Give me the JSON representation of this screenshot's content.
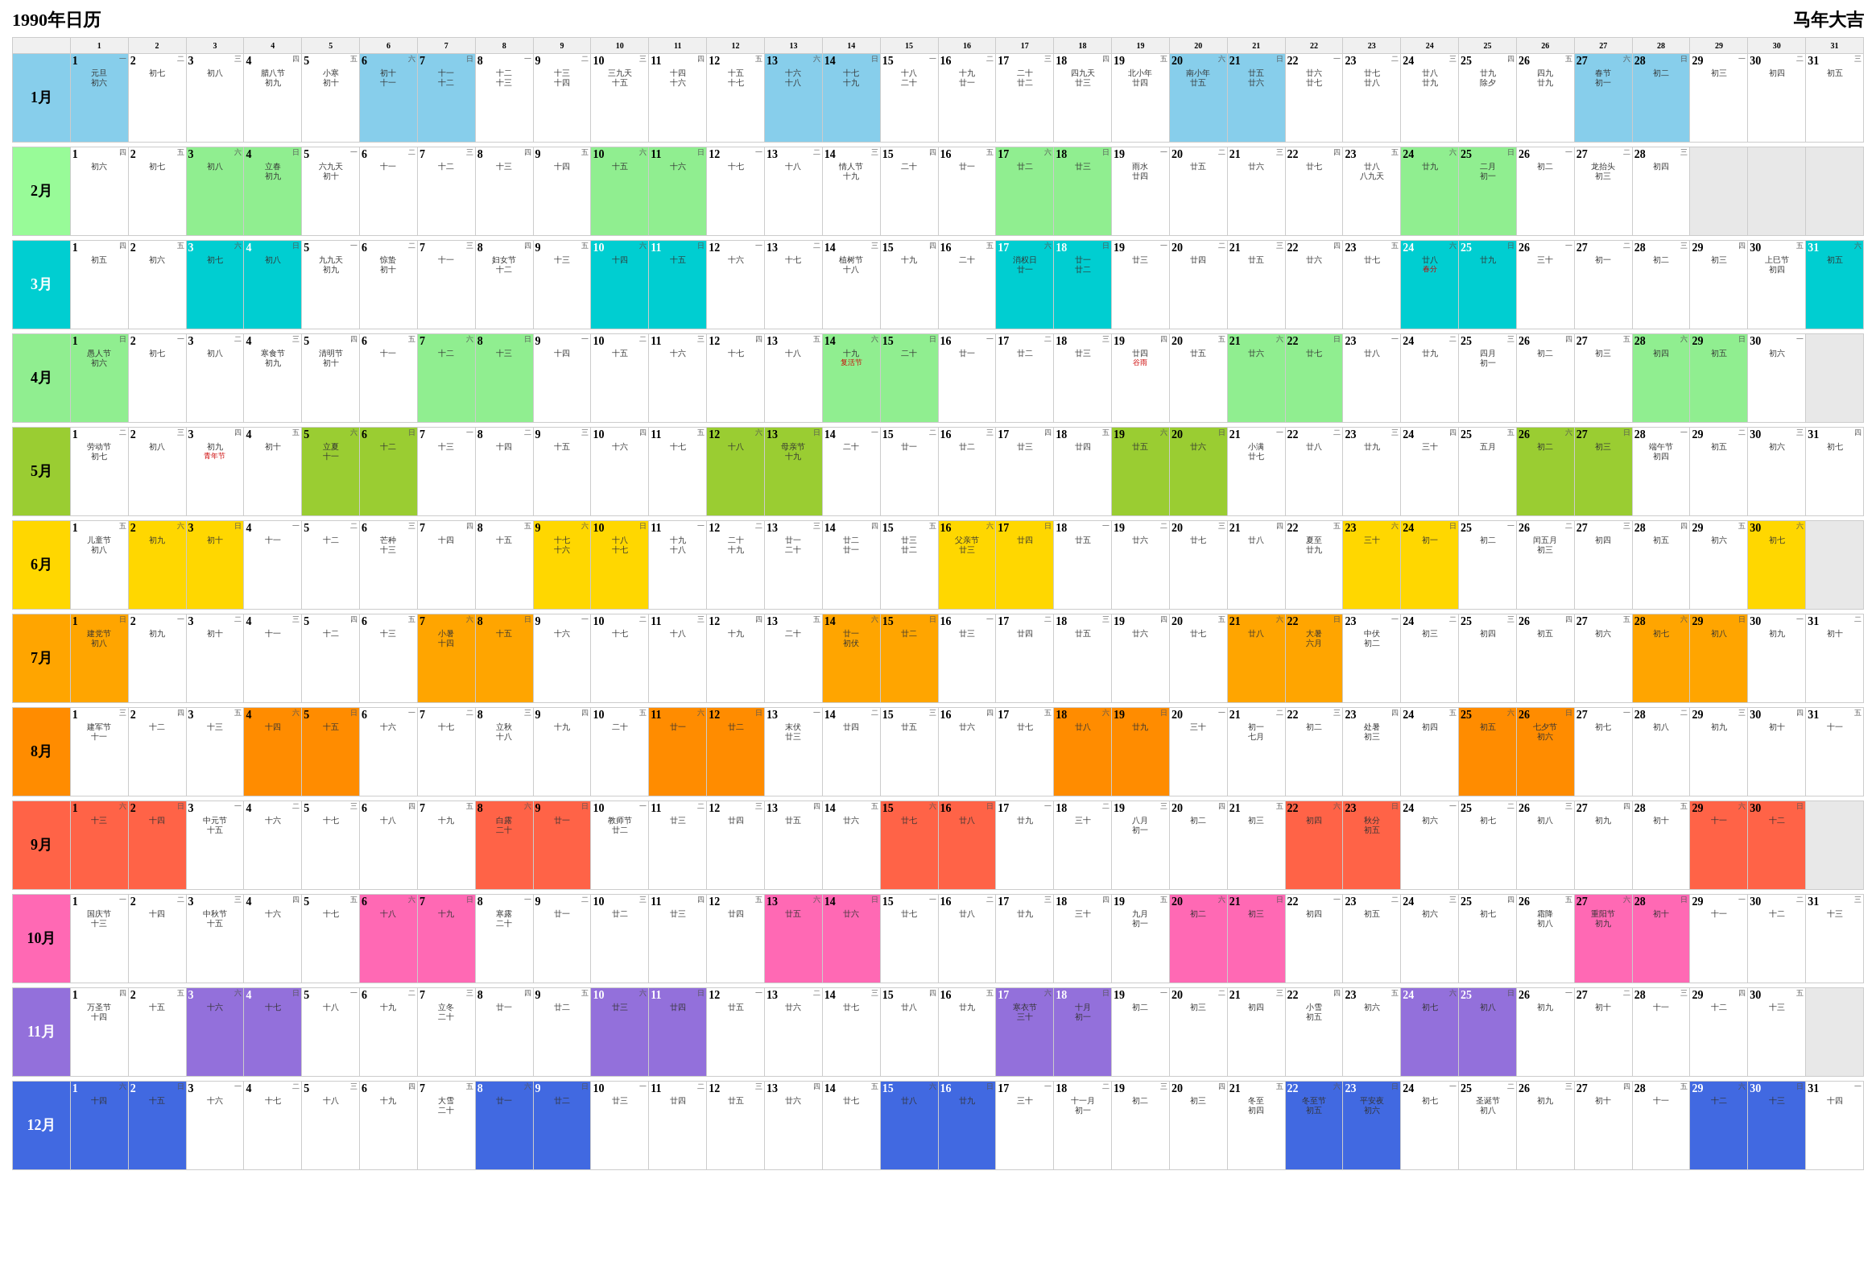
{
  "header": {
    "title": "1990年日历",
    "subtitle": "马年大吉"
  },
  "months": [
    {
      "id": 1,
      "label": "1月",
      "colorClass": "month-label-jan",
      "days": 31
    },
    {
      "id": 2,
      "label": "2月",
      "colorClass": "month-label-feb",
      "days": 28
    },
    {
      "id": 3,
      "label": "3月",
      "colorClass": "month-label-mar",
      "days": 31
    },
    {
      "id": 4,
      "label": "4月",
      "colorClass": "month-label-apr",
      "days": 30
    },
    {
      "id": 5,
      "label": "5月",
      "colorClass": "month-label-may",
      "days": 31
    },
    {
      "id": 6,
      "label": "6月",
      "colorClass": "month-label-jun",
      "days": 30
    },
    {
      "id": 7,
      "label": "7月",
      "colorClass": "month-label-jul",
      "days": 31
    },
    {
      "id": 8,
      "label": "8月",
      "colorClass": "month-label-aug",
      "days": 31
    },
    {
      "id": 9,
      "label": "9月",
      "colorClass": "month-label-sep",
      "days": 30
    },
    {
      "id": 10,
      "label": "10月",
      "colorClass": "month-label-oct",
      "days": 31
    },
    {
      "id": 11,
      "label": "11月",
      "colorClass": "month-label-nov",
      "days": 30
    },
    {
      "id": 12,
      "label": "12月",
      "colorClass": "month-label-dec",
      "days": 31
    }
  ]
}
